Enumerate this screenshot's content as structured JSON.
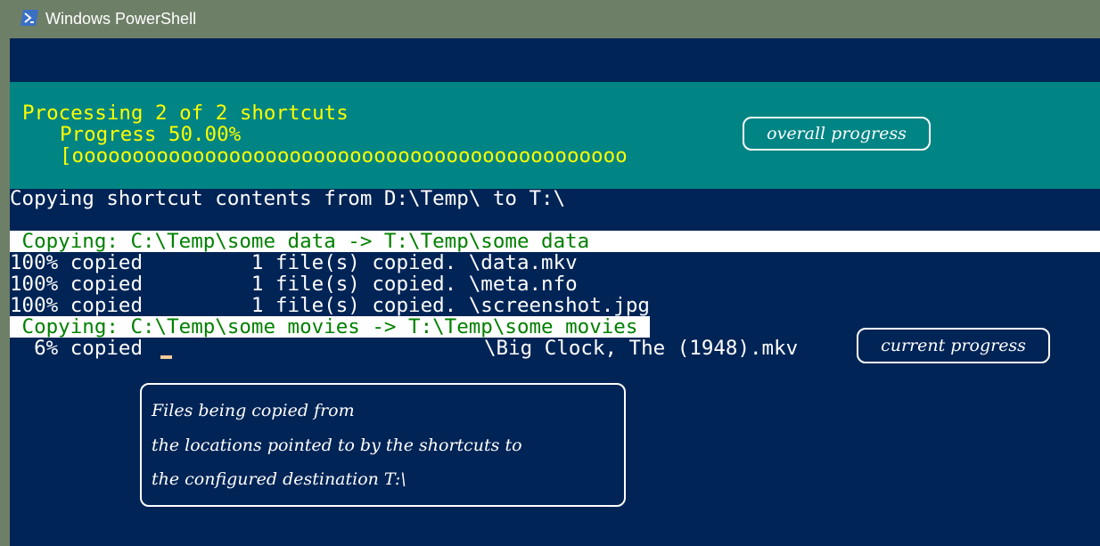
{
  "window": {
    "title": "Windows PowerShell",
    "icon": "powershell-icon"
  },
  "colors": {
    "console_bg": "#012456",
    "progress_bg": "#008484",
    "progress_text": "#ffff00",
    "copy_header_text": "#008000",
    "copy_header_bg": "#ffffff"
  },
  "progress_panel": {
    "activity": "Processing 2 of 2 shortcuts",
    "status": "Progress 50.00%",
    "bar": "[oooooooooooooooooooooooooooooooooooooooooooooo",
    "percent": 50
  },
  "console": {
    "lines": [
      "Copying shortcut contents from D:\\Temp\\ to T:\\",
      " Copying: C:\\Temp\\some data -> T:\\Temp\\some data",
      "100% copied         1 file(s) copied. \\data.mkv",
      "100% copied         1 file(s) copied. \\meta.nfo",
      "100% copied         1 file(s) copied. \\screenshot.jpg",
      " Copying: C:\\Temp\\some movies -> T:\\Temp\\some movies ",
      "  6% copied ",
      "\\Big Clock, The (1948).mkv"
    ]
  },
  "annotations": {
    "overall": "overall progress",
    "current": "current progress",
    "note_lines": [
      "Files being copied from",
      "the locations pointed to by the shortcuts to",
      "the configured destination T:\\"
    ]
  }
}
